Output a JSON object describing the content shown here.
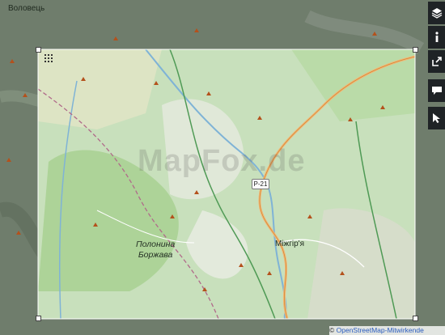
{
  "map": {
    "places": {
      "volovets": "Воловець",
      "mizhhirya": "Міжгір'я",
      "polonyna_line1": "Полонина",
      "polonyna_line2": "Боржава"
    },
    "road_shield": "P-21",
    "watermark": "MapFox.de"
  },
  "attribution": {
    "prefix": "© ",
    "link": "OpenStreetMap-Mitwirkende"
  },
  "toolbar": {
    "icons": [
      "layers-icon",
      "info-icon",
      "share-icon",
      "comment-icon",
      "pointer-icon"
    ]
  },
  "colors": {
    "map_base": "#6f7d6c",
    "map_selection": "#c8e0bc",
    "forest": "#a6cf8f",
    "road": "#f3b874",
    "river": "#7fb3d6",
    "boundary": "#b06a8a",
    "toolbar": "#1f2326"
  }
}
